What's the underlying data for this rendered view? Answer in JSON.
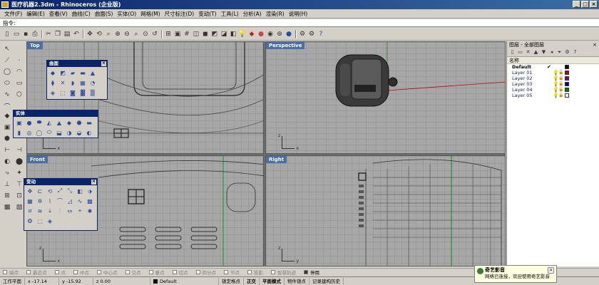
{
  "window": {
    "title": "医疗机器2.3dm - Rhinoceros (企业版)"
  },
  "menu": [
    "文件(F)",
    "编辑(E)",
    "查看(V)",
    "曲线(C)",
    "曲面(S)",
    "实体(O)",
    "网格(M)",
    "尺寸标注(D)",
    "变动(T)",
    "工具(L)",
    "分析(A)",
    "渲染(R)",
    "说明(H)"
  ],
  "command": {
    "label": "指令:"
  },
  "viewports": {
    "top": "Top",
    "perspective": "Perspective",
    "front": "Front",
    "right": "Right"
  },
  "floatbars": {
    "surface": "曲面",
    "solid": "实体",
    "transform": "变动"
  },
  "layers": {
    "title": "图层 - 全部图层",
    "header_name": "名称",
    "rows": [
      {
        "name": "Default",
        "current": "✔",
        "color": "#000000"
      },
      {
        "name": "Layer 01",
        "current": "",
        "color": "#c00000"
      },
      {
        "name": "Layer 02",
        "current": "",
        "color": "#800080"
      },
      {
        "name": "Layer 03",
        "current": "",
        "color": "#000080"
      },
      {
        "name": "Layer 04",
        "current": "",
        "color": "#008000"
      },
      {
        "name": "Layer 05",
        "current": "",
        "color": "#ffffff"
      }
    ]
  },
  "osnap": [
    {
      "label": "端点",
      "checked": false
    },
    {
      "label": "最近点",
      "checked": false
    },
    {
      "label": "点",
      "checked": false
    },
    {
      "label": "中点",
      "checked": false
    },
    {
      "label": "中心点",
      "checked": false
    },
    {
      "label": "交点",
      "checked": false
    },
    {
      "label": "垂点",
      "checked": false
    },
    {
      "label": "切点",
      "checked": false
    },
    {
      "label": "四分点",
      "checked": false
    },
    {
      "label": "节点",
      "checked": false
    },
    {
      "label": "投影",
      "checked": false
    },
    {
      "label": "智慧轨迹",
      "checked": false
    },
    {
      "label": "停用",
      "checked": true
    }
  ],
  "status": {
    "plane": "工作平面",
    "x": "x -17.14",
    "y": "y -15.92",
    "z": "z 0.00",
    "layer": "Default",
    "grid_snap": "锁定格点",
    "ortho": "正交",
    "planar": "平面模式",
    "osnap": "物件锁点",
    "history": "记录建构历史"
  },
  "notification": {
    "title": "奇艺影音",
    "message": "网络已连接，欢迎使用奇艺影音"
  },
  "icons": {
    "toolbar": [
      "new-file-icon",
      "open-icon",
      "save-icon",
      "print-icon",
      "cut-icon",
      "copy-icon",
      "paste-icon",
      "undo-icon",
      "pan-icon",
      "rotate-view-icon",
      "zoom-icon",
      "zoom-window-icon",
      "zoom-extents-icon",
      "grid-icon",
      "light-icon",
      "render-icon",
      "color-icon",
      "sphere-icon",
      "settings-icon",
      "help-icon"
    ]
  }
}
